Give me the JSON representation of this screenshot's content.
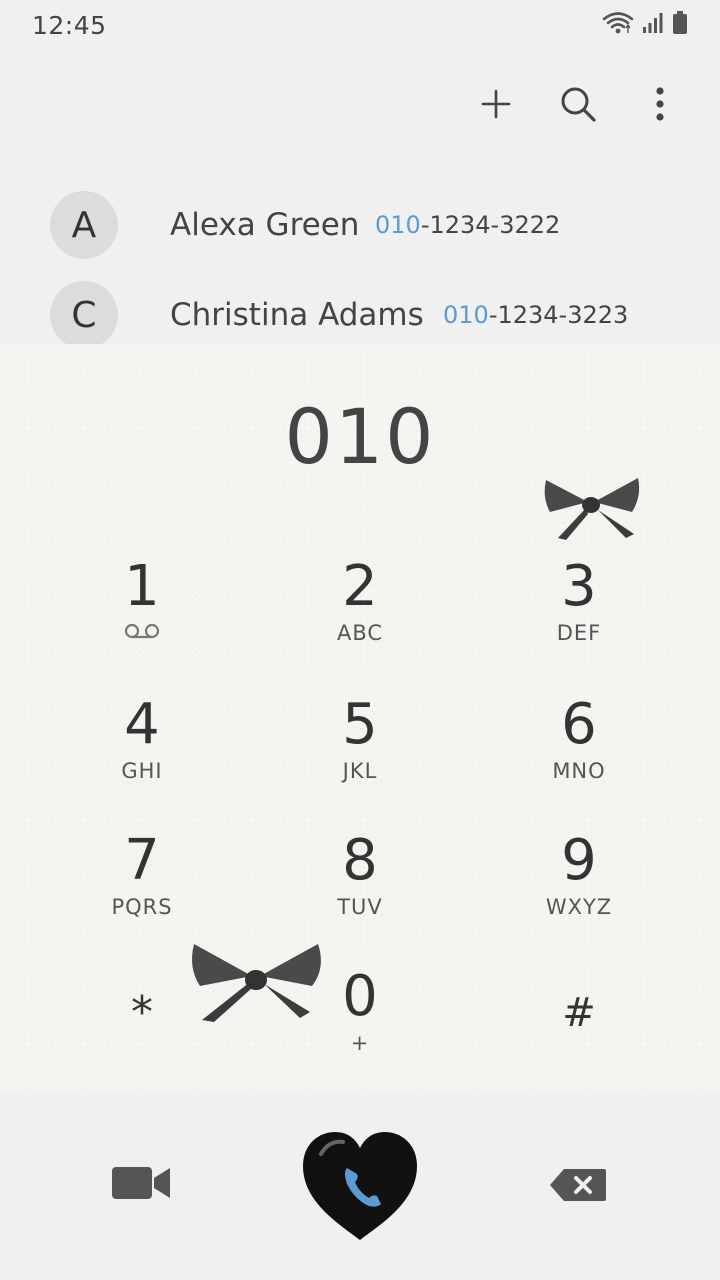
{
  "status_bar": {
    "time": "12:45",
    "icons": [
      "wifi-icon",
      "signal-icon",
      "battery-icon"
    ]
  },
  "toolbar": {
    "icons": [
      "plus-icon",
      "search-icon",
      "more-vertical-icon"
    ]
  },
  "suggestions": [
    {
      "initial": "A",
      "name": "Alexa Green",
      "number_match": "010",
      "number_rest": "-1234-3222"
    },
    {
      "initial": "C",
      "name": "Christina Adams",
      "number_match": "010",
      "number_rest": "-1234-3223"
    }
  ],
  "dialer": {
    "entered_number": "010",
    "keys": [
      {
        "digit": "1",
        "letters": "",
        "sub_icon": "voicemail-icon"
      },
      {
        "digit": "2",
        "letters": "ABC"
      },
      {
        "digit": "3",
        "letters": "DEF"
      },
      {
        "digit": "4",
        "letters": "GHI"
      },
      {
        "digit": "5",
        "letters": "JKL"
      },
      {
        "digit": "6",
        "letters": "MNO"
      },
      {
        "digit": "7",
        "letters": "PQRS"
      },
      {
        "digit": "8",
        "letters": "TUV"
      },
      {
        "digit": "9",
        "letters": "WXYZ"
      },
      {
        "digit": "*",
        "letters": ""
      },
      {
        "digit": "0",
        "letters": "+"
      },
      {
        "digit": "#",
        "letters": ""
      }
    ]
  },
  "bottom_bar": {
    "icons": [
      "video-call-icon",
      "call-heart-icon",
      "backspace-icon"
    ]
  },
  "colors": {
    "match_highlight": "#5b9bd1",
    "call_icon_blue": "#5b9bd1",
    "background": "#f0f0f0"
  }
}
